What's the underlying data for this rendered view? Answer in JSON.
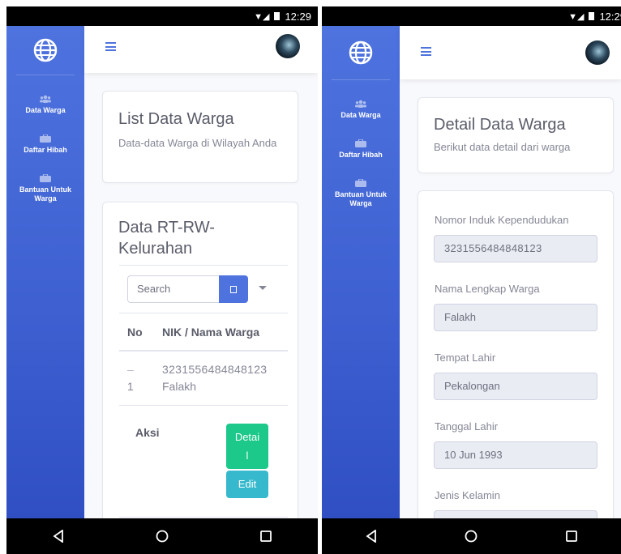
{
  "status": {
    "time": "12:29"
  },
  "sidebar": {
    "items": [
      {
        "label": "Data Warga",
        "icon": "users-icon"
      },
      {
        "label": "Daftar Hibah",
        "icon": "briefcase-icon"
      },
      {
        "label": "Bantuan Untuk Warga",
        "icon": "briefcase-icon"
      }
    ]
  },
  "list_page": {
    "header_title": "List Data Warga",
    "header_subtitle": "Data-data Warga di Wilayah Anda",
    "table_card_title": "Data RT-RW-Kelurahan",
    "search_placeholder": "Search",
    "columns": {
      "no": "No",
      "nik_nama": "NIK / Nama Warga"
    },
    "rows": [
      {
        "no": "1",
        "nik": "3231556484848123",
        "nama": "Falakh",
        "aksi_label": "Aksi",
        "detail_label": "Detail",
        "edit_label": "Edit"
      }
    ]
  },
  "detail_page": {
    "header_title": "Detail Data Warga",
    "header_subtitle": "Berikut data detail dari warga",
    "fields": [
      {
        "label": "Nomor Induk Kependudukan",
        "value": "3231556484848123"
      },
      {
        "label": "Nama Lengkap Warga",
        "value": "Falakh"
      },
      {
        "label": "Tempat Lahir",
        "value": "Pekalongan"
      },
      {
        "label": "Tanggal Lahir",
        "value": "10 Jun 1993"
      },
      {
        "label": "Jenis Kelamin",
        "value": ""
      }
    ]
  }
}
